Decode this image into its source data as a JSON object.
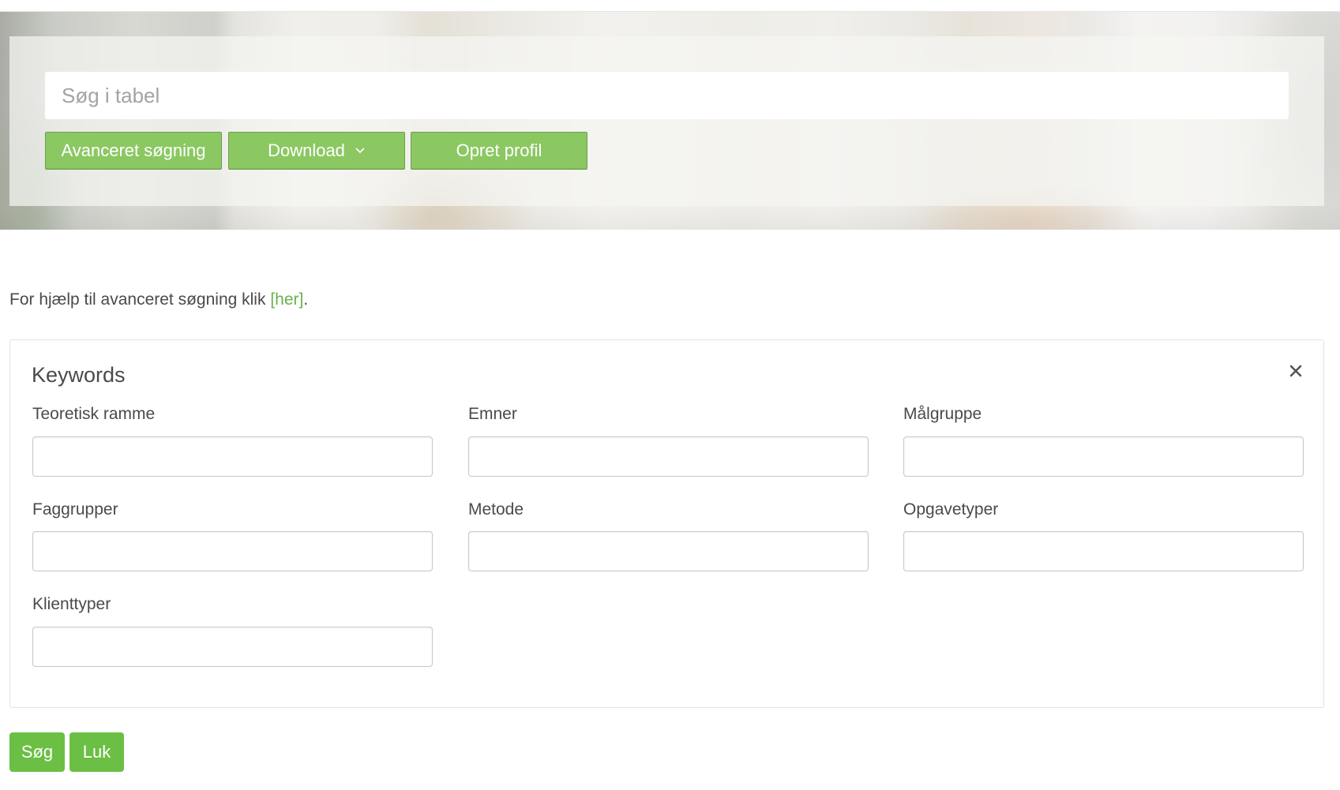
{
  "search": {
    "placeholder": "Søg i tabel"
  },
  "toolbar": {
    "advanced_label": "Avanceret søgning",
    "download_label": "Download",
    "create_profile_label": "Opret profil"
  },
  "help": {
    "text": "For hjælp til avanceret søgning klik ",
    "link": "[her]",
    "suffix": "."
  },
  "keywords": {
    "title": "Keywords",
    "fields": [
      {
        "label": "Teoretisk ramme",
        "value": ""
      },
      {
        "label": "Emner",
        "value": ""
      },
      {
        "label": "Målgruppe",
        "value": ""
      },
      {
        "label": "Faggrupper",
        "value": ""
      },
      {
        "label": "Metode",
        "value": ""
      },
      {
        "label": "Opgavetyper",
        "value": ""
      },
      {
        "label": "Klienttyper",
        "value": ""
      }
    ]
  },
  "actions": {
    "search_label": "Søg",
    "close_label": "Luk"
  },
  "colors": {
    "accent": "#8bc862",
    "action": "#6bbf44",
    "link": "#6ab04c"
  }
}
